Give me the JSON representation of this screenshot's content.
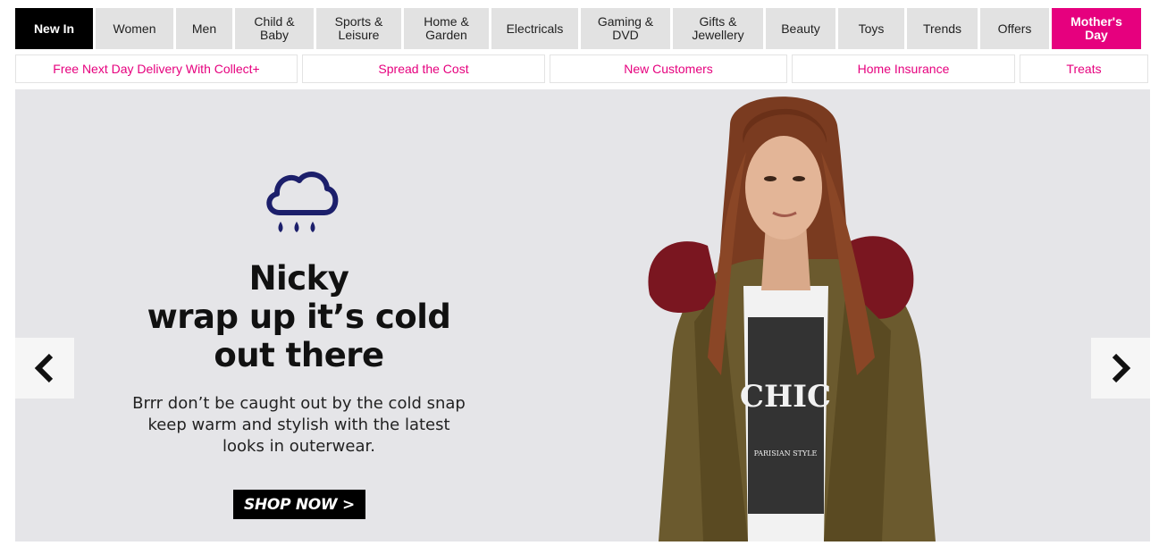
{
  "nav": {
    "items": [
      {
        "label": "New In"
      },
      {
        "label": "Women"
      },
      {
        "label": "Men"
      },
      {
        "label": "Child &\nBaby"
      },
      {
        "label": "Sports &\nLeisure"
      },
      {
        "label": "Home &\nGarden"
      },
      {
        "label": "Electricals"
      },
      {
        "label": "Gaming &\nDVD"
      },
      {
        "label": "Gifts &\nJewellery"
      },
      {
        "label": "Beauty"
      },
      {
        "label": "Toys"
      },
      {
        "label": "Trends"
      },
      {
        "label": "Offers"
      },
      {
        "label": "Mother's\nDay"
      }
    ]
  },
  "sublinks": [
    {
      "label": "Free Next Day Delivery With Collect+"
    },
    {
      "label": "Spread the Cost"
    },
    {
      "label": "New Customers"
    },
    {
      "label": "Home Insurance"
    },
    {
      "label": "Treats"
    }
  ],
  "hero": {
    "icon": "rain-cloud-icon",
    "headline": "Nicky\nwrap up it’s cold\nout there",
    "body": "Brrr don’t be caught out by the cold snap\nkeep warm and stylish with the latest\nlooks in outerwear.",
    "cta": "SHOP NOW >",
    "shirt_text": "CHIC",
    "shirt_small": "PARISIAN STYLE"
  },
  "colors": {
    "accent": "#e6007e",
    "icon": "#1c1f6b",
    "hero_bg": "#e5e5e8"
  }
}
